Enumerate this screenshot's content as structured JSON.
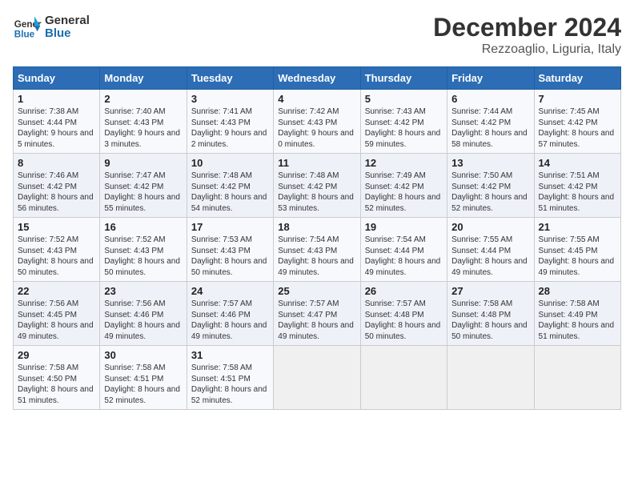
{
  "header": {
    "logo_line1": "General",
    "logo_line2": "Blue",
    "month": "December 2024",
    "location": "Rezzoaglio, Liguria, Italy"
  },
  "days_of_week": [
    "Sunday",
    "Monday",
    "Tuesday",
    "Wednesday",
    "Thursday",
    "Friday",
    "Saturday"
  ],
  "weeks": [
    [
      {
        "day": "1",
        "info": "Sunrise: 7:38 AM\nSunset: 4:44 PM\nDaylight: 9 hours and 5 minutes."
      },
      {
        "day": "2",
        "info": "Sunrise: 7:40 AM\nSunset: 4:43 PM\nDaylight: 9 hours and 3 minutes."
      },
      {
        "day": "3",
        "info": "Sunrise: 7:41 AM\nSunset: 4:43 PM\nDaylight: 9 hours and 2 minutes."
      },
      {
        "day": "4",
        "info": "Sunrise: 7:42 AM\nSunset: 4:43 PM\nDaylight: 9 hours and 0 minutes."
      },
      {
        "day": "5",
        "info": "Sunrise: 7:43 AM\nSunset: 4:42 PM\nDaylight: 8 hours and 59 minutes."
      },
      {
        "day": "6",
        "info": "Sunrise: 7:44 AM\nSunset: 4:42 PM\nDaylight: 8 hours and 58 minutes."
      },
      {
        "day": "7",
        "info": "Sunrise: 7:45 AM\nSunset: 4:42 PM\nDaylight: 8 hours and 57 minutes."
      }
    ],
    [
      {
        "day": "8",
        "info": "Sunrise: 7:46 AM\nSunset: 4:42 PM\nDaylight: 8 hours and 56 minutes."
      },
      {
        "day": "9",
        "info": "Sunrise: 7:47 AM\nSunset: 4:42 PM\nDaylight: 8 hours and 55 minutes."
      },
      {
        "day": "10",
        "info": "Sunrise: 7:48 AM\nSunset: 4:42 PM\nDaylight: 8 hours and 54 minutes."
      },
      {
        "day": "11",
        "info": "Sunrise: 7:48 AM\nSunset: 4:42 PM\nDaylight: 8 hours and 53 minutes."
      },
      {
        "day": "12",
        "info": "Sunrise: 7:49 AM\nSunset: 4:42 PM\nDaylight: 8 hours and 52 minutes."
      },
      {
        "day": "13",
        "info": "Sunrise: 7:50 AM\nSunset: 4:42 PM\nDaylight: 8 hours and 52 minutes."
      },
      {
        "day": "14",
        "info": "Sunrise: 7:51 AM\nSunset: 4:42 PM\nDaylight: 8 hours and 51 minutes."
      }
    ],
    [
      {
        "day": "15",
        "info": "Sunrise: 7:52 AM\nSunset: 4:43 PM\nDaylight: 8 hours and 50 minutes."
      },
      {
        "day": "16",
        "info": "Sunrise: 7:52 AM\nSunset: 4:43 PM\nDaylight: 8 hours and 50 minutes."
      },
      {
        "day": "17",
        "info": "Sunrise: 7:53 AM\nSunset: 4:43 PM\nDaylight: 8 hours and 50 minutes."
      },
      {
        "day": "18",
        "info": "Sunrise: 7:54 AM\nSunset: 4:43 PM\nDaylight: 8 hours and 49 minutes."
      },
      {
        "day": "19",
        "info": "Sunrise: 7:54 AM\nSunset: 4:44 PM\nDaylight: 8 hours and 49 minutes."
      },
      {
        "day": "20",
        "info": "Sunrise: 7:55 AM\nSunset: 4:44 PM\nDaylight: 8 hours and 49 minutes."
      },
      {
        "day": "21",
        "info": "Sunrise: 7:55 AM\nSunset: 4:45 PM\nDaylight: 8 hours and 49 minutes."
      }
    ],
    [
      {
        "day": "22",
        "info": "Sunrise: 7:56 AM\nSunset: 4:45 PM\nDaylight: 8 hours and 49 minutes."
      },
      {
        "day": "23",
        "info": "Sunrise: 7:56 AM\nSunset: 4:46 PM\nDaylight: 8 hours and 49 minutes."
      },
      {
        "day": "24",
        "info": "Sunrise: 7:57 AM\nSunset: 4:46 PM\nDaylight: 8 hours and 49 minutes."
      },
      {
        "day": "25",
        "info": "Sunrise: 7:57 AM\nSunset: 4:47 PM\nDaylight: 8 hours and 49 minutes."
      },
      {
        "day": "26",
        "info": "Sunrise: 7:57 AM\nSunset: 4:48 PM\nDaylight: 8 hours and 50 minutes."
      },
      {
        "day": "27",
        "info": "Sunrise: 7:58 AM\nSunset: 4:48 PM\nDaylight: 8 hours and 50 minutes."
      },
      {
        "day": "28",
        "info": "Sunrise: 7:58 AM\nSunset: 4:49 PM\nDaylight: 8 hours and 51 minutes."
      }
    ],
    [
      {
        "day": "29",
        "info": "Sunrise: 7:58 AM\nSunset: 4:50 PM\nDaylight: 8 hours and 51 minutes."
      },
      {
        "day": "30",
        "info": "Sunrise: 7:58 AM\nSunset: 4:51 PM\nDaylight: 8 hours and 52 minutes."
      },
      {
        "day": "31",
        "info": "Sunrise: 7:58 AM\nSunset: 4:51 PM\nDaylight: 8 hours and 52 minutes."
      },
      {
        "day": "",
        "info": ""
      },
      {
        "day": "",
        "info": ""
      },
      {
        "day": "",
        "info": ""
      },
      {
        "day": "",
        "info": ""
      }
    ]
  ]
}
